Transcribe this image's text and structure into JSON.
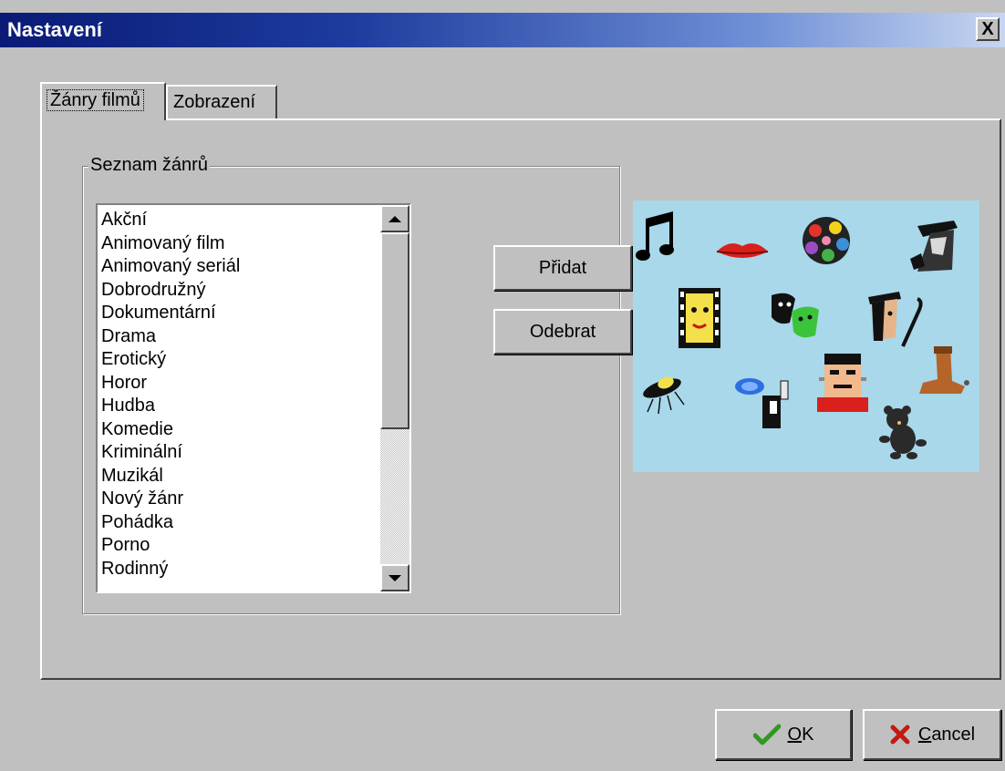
{
  "window": {
    "title": "Nastavení",
    "close_label": "X"
  },
  "tabs": [
    {
      "label": "Žánry filmů",
      "active": true
    },
    {
      "label": "Zobrazení",
      "active": false
    }
  ],
  "genre_group": {
    "legend": "Seznam žánrů",
    "items": [
      "Akční",
      "Animovaný film",
      "Animovaný seriál",
      "Dobrodružný",
      "Dokumentární",
      "Drama",
      "Erotický",
      "Horor",
      "Hudba",
      "Komedie",
      "Kriminální",
      "Muzikál",
      "Nový žánr",
      "Pohádka",
      "Porno",
      "Rodinný"
    ]
  },
  "buttons": {
    "add_label": "Přidat",
    "remove_label": "Odebrat",
    "ok_accel": "O",
    "ok_rest": "K",
    "cancel_accel": "C",
    "cancel_rest": "ancel"
  },
  "colors": {
    "titlebar_start": "#0a1a76",
    "titlebar_end": "#c7d6f0",
    "picture_bg": "#a8d8ea",
    "ok_check": "#2e9a1e",
    "cancel_x": "#c41a12"
  },
  "picture_icons": [
    "music-note-icon",
    "lips-icon",
    "film-reel-icon",
    "detective-icon",
    "film-strip-face-icon",
    "theater-masks-icon",
    "villain-cane-icon",
    "ufo-icon",
    "magician-icon",
    "frankenstein-icon",
    "cowboy-boot-icon",
    "teddy-bear-icon"
  ]
}
